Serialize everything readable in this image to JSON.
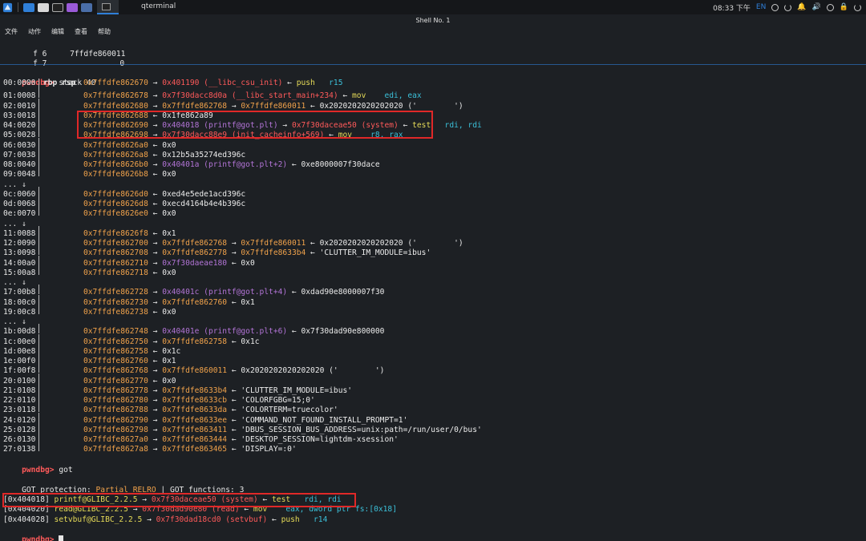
{
  "panel": {
    "task_title": "qterminal",
    "clock": "08:33 下午",
    "lang": "EN"
  },
  "window": {
    "title": "Shell No. 1"
  },
  "menu": {
    "items": [
      "文件",
      "动作",
      "编辑",
      "查看",
      "帮助"
    ]
  },
  "regs": [
    {
      "name": "f 6",
      "value": "7ffdfe860011"
    },
    {
      "name": "f 7",
      "value": "0"
    }
  ],
  "prompt": "pwndbg>",
  "cmd_stack": "stack 40",
  "stack": [
    {
      "idx": "00:0000",
      "tag": "rbp rsp",
      "addr": "0x7ffdfe862670",
      "segs": [
        {
          "t": " → ",
          "c": "white"
        },
        {
          "t": "0x401190 (__libc_csu_init)",
          "c": "red"
        },
        {
          "t": " ← ",
          "c": "white"
        },
        {
          "t": "push",
          "c": "yellow"
        },
        {
          "t": "   r15",
          "c": "cyan"
        }
      ]
    },
    {
      "idx": "01:0008",
      "tag": "",
      "addr": "0x7ffdfe862678",
      "segs": [
        {
          "t": " → ",
          "c": "white"
        },
        {
          "t": "0x7f30dacc8d0a (__libc_start_main+234)",
          "c": "red"
        },
        {
          "t": " ← ",
          "c": "white"
        },
        {
          "t": "mov",
          "c": "yellow"
        },
        {
          "t": "    edi, eax",
          "c": "cyan"
        }
      ]
    },
    {
      "idx": "02:0010",
      "tag": "",
      "addr": "0x7ffdfe862680",
      "segs": [
        {
          "t": " → ",
          "c": "white"
        },
        {
          "t": "0x7ffdfe862768",
          "c": "orange"
        },
        {
          "t": " → ",
          "c": "white"
        },
        {
          "t": "0x7ffdfe860011",
          "c": "orange"
        },
        {
          "t": " ← 0x2020202020202020 ('        ')",
          "c": "white"
        }
      ]
    },
    {
      "idx": "03:0018",
      "tag": "",
      "addr": "0x7ffdfe862688",
      "segs": [
        {
          "t": " ← 0x1fe862a89",
          "c": "white"
        }
      ]
    },
    {
      "idx": "04:0020",
      "tag": "",
      "addr": "0x7ffdfe862690",
      "segs": [
        {
          "t": " → ",
          "c": "white"
        },
        {
          "t": "0x404018 (printf@got.plt)",
          "c": "purple"
        },
        {
          "t": " → ",
          "c": "white"
        },
        {
          "t": "0x7f30daceae50 (system)",
          "c": "red"
        },
        {
          "t": " ← ",
          "c": "white"
        },
        {
          "t": "test",
          "c": "yellow"
        },
        {
          "t": "   rdi, rdi",
          "c": "cyan"
        }
      ]
    },
    {
      "idx": "05:0028",
      "tag": "",
      "addr": "0x7ffdfe862698",
      "segs": [
        {
          "t": " → ",
          "c": "white"
        },
        {
          "t": "0x7f30dacc88e9 (init_cacheinfo+569)",
          "c": "red"
        },
        {
          "t": " ← ",
          "c": "white"
        },
        {
          "t": "mov",
          "c": "yellow"
        },
        {
          "t": "    r8, rax",
          "c": "cyan"
        }
      ]
    },
    {
      "idx": "06:0030",
      "tag": "",
      "addr": "0x7ffdfe8626a0",
      "segs": [
        {
          "t": " ← 0x0",
          "c": "white"
        }
      ]
    },
    {
      "idx": "07:0038",
      "tag": "",
      "addr": "0x7ffdfe8626a8",
      "segs": [
        {
          "t": " ← 0x12b5a35274ed396c",
          "c": "white"
        }
      ]
    },
    {
      "idx": "08:0040",
      "tag": "",
      "addr": "0x7ffdfe8626b0",
      "segs": [
        {
          "t": " → ",
          "c": "white"
        },
        {
          "t": "0x40401a (printf@got.plt+2)",
          "c": "purple"
        },
        {
          "t": " ← 0xe8000007f30dace",
          "c": "white"
        }
      ]
    },
    {
      "idx": "09:0048",
      "tag": "",
      "addr": "0x7ffdfe8626b8",
      "segs": [
        {
          "t": " ← 0x0",
          "c": "white"
        }
      ]
    },
    {
      "idx": "... ↓",
      "tag": "",
      "addr": "",
      "segs": []
    },
    {
      "idx": "0c:0060",
      "tag": "",
      "addr": "0x7ffdfe8626d0",
      "segs": [
        {
          "t": " ← 0xed4e5ede1acd396c",
          "c": "white"
        }
      ]
    },
    {
      "idx": "0d:0068",
      "tag": "",
      "addr": "0x7ffdfe8626d8",
      "segs": [
        {
          "t": " ← 0xecd4164b4e4b396c",
          "c": "white"
        }
      ]
    },
    {
      "idx": "0e:0070",
      "tag": "",
      "addr": "0x7ffdfe8626e0",
      "segs": [
        {
          "t": " ← 0x0",
          "c": "white"
        }
      ]
    },
    {
      "idx": "... ↓",
      "tag": "",
      "addr": "",
      "segs": []
    },
    {
      "idx": "11:0088",
      "tag": "",
      "addr": "0x7ffdfe8626f8",
      "segs": [
        {
          "t": " ← 0x1",
          "c": "white"
        }
      ]
    },
    {
      "idx": "12:0090",
      "tag": "",
      "addr": "0x7ffdfe862700",
      "segs": [
        {
          "t": " → ",
          "c": "white"
        },
        {
          "t": "0x7ffdfe862768",
          "c": "orange"
        },
        {
          "t": " → ",
          "c": "white"
        },
        {
          "t": "0x7ffdfe860011",
          "c": "orange"
        },
        {
          "t": " ← 0x2020202020202020 ('        ')",
          "c": "white"
        }
      ]
    },
    {
      "idx": "13:0098",
      "tag": "",
      "addr": "0x7ffdfe862708",
      "segs": [
        {
          "t": " → ",
          "c": "white"
        },
        {
          "t": "0x7ffdfe862778",
          "c": "orange"
        },
        {
          "t": " → ",
          "c": "white"
        },
        {
          "t": "0x7ffdfe8633b4",
          "c": "orange"
        },
        {
          "t": " ← 'CLUTTER_IM_MODULE=ibus'",
          "c": "white"
        }
      ]
    },
    {
      "idx": "14:00a0",
      "tag": "",
      "addr": "0x7ffdfe862710",
      "segs": [
        {
          "t": " → ",
          "c": "white"
        },
        {
          "t": "0x7f30daeae180",
          "c": "purple"
        },
        {
          "t": " ← 0x0",
          "c": "white"
        }
      ]
    },
    {
      "idx": "15:00a8",
      "tag": "",
      "addr": "0x7ffdfe862718",
      "segs": [
        {
          "t": " ← 0x0",
          "c": "white"
        }
      ]
    },
    {
      "idx": "... ↓",
      "tag": "",
      "addr": "",
      "segs": []
    },
    {
      "idx": "17:00b8",
      "tag": "",
      "addr": "0x7ffdfe862728",
      "segs": [
        {
          "t": " → ",
          "c": "white"
        },
        {
          "t": "0x40401c (printf@got.plt+4)",
          "c": "purple"
        },
        {
          "t": " ← 0xdad90e8000007f30",
          "c": "white"
        }
      ]
    },
    {
      "idx": "18:00c0",
      "tag": "",
      "addr": "0x7ffdfe862730",
      "segs": [
        {
          "t": " → ",
          "c": "white"
        },
        {
          "t": "0x7ffdfe862760",
          "c": "orange"
        },
        {
          "t": " ← 0x1",
          "c": "white"
        }
      ]
    },
    {
      "idx": "19:00c8",
      "tag": "",
      "addr": "0x7ffdfe862738",
      "segs": [
        {
          "t": " ← 0x0",
          "c": "white"
        }
      ]
    },
    {
      "idx": "... ↓",
      "tag": "",
      "addr": "",
      "segs": []
    },
    {
      "idx": "1b:00d8",
      "tag": "",
      "addr": "0x7ffdfe862748",
      "segs": [
        {
          "t": " → ",
          "c": "white"
        },
        {
          "t": "0x40401e (printf@got.plt+6)",
          "c": "purple"
        },
        {
          "t": " ← 0x7f30dad90e800000",
          "c": "white"
        }
      ]
    },
    {
      "idx": "1c:00e0",
      "tag": "",
      "addr": "0x7ffdfe862750",
      "segs": [
        {
          "t": " → ",
          "c": "white"
        },
        {
          "t": "0x7ffdfe862758",
          "c": "orange"
        },
        {
          "t": " ← 0x1c",
          "c": "white"
        }
      ]
    },
    {
      "idx": "1d:00e8",
      "tag": "",
      "addr": "0x7ffdfe862758",
      "segs": [
        {
          "t": " ← 0x1c",
          "c": "white"
        }
      ]
    },
    {
      "idx": "1e:00f0",
      "tag": "",
      "addr": "0x7ffdfe862760",
      "segs": [
        {
          "t": " ← 0x1",
          "c": "white"
        }
      ]
    },
    {
      "idx": "1f:00f8",
      "tag": "",
      "addr": "0x7ffdfe862768",
      "segs": [
        {
          "t": " → ",
          "c": "white"
        },
        {
          "t": "0x7ffdfe860011",
          "c": "orange"
        },
        {
          "t": " ← 0x2020202020202020 ('        ')",
          "c": "white"
        }
      ]
    },
    {
      "idx": "20:0100",
      "tag": "",
      "addr": "0x7ffdfe862770",
      "segs": [
        {
          "t": " ← 0x0",
          "c": "white"
        }
      ]
    },
    {
      "idx": "21:0108",
      "tag": "",
      "addr": "0x7ffdfe862778",
      "segs": [
        {
          "t": " → ",
          "c": "white"
        },
        {
          "t": "0x7ffdfe8633b4",
          "c": "orange"
        },
        {
          "t": " ← 'CLUTTER_IM_MODULE=ibus'",
          "c": "white"
        }
      ]
    },
    {
      "idx": "22:0110",
      "tag": "",
      "addr": "0x7ffdfe862780",
      "segs": [
        {
          "t": " → ",
          "c": "white"
        },
        {
          "t": "0x7ffdfe8633cb",
          "c": "orange"
        },
        {
          "t": " ← 'COLORFGBG=15;0'",
          "c": "white"
        }
      ]
    },
    {
      "idx": "23:0118",
      "tag": "",
      "addr": "0x7ffdfe862788",
      "segs": [
        {
          "t": " → ",
          "c": "white"
        },
        {
          "t": "0x7ffdfe8633da",
          "c": "orange"
        },
        {
          "t": " ← 'COLORTERM=truecolor'",
          "c": "white"
        }
      ]
    },
    {
      "idx": "24:0120",
      "tag": "",
      "addr": "0x7ffdfe862790",
      "segs": [
        {
          "t": " → ",
          "c": "white"
        },
        {
          "t": "0x7ffdfe8633ee",
          "c": "orange"
        },
        {
          "t": " ← 'COMMAND_NOT_FOUND_INSTALL_PROMPT=1'",
          "c": "white"
        }
      ]
    },
    {
      "idx": "25:0128",
      "tag": "",
      "addr": "0x7ffdfe862798",
      "segs": [
        {
          "t": " → ",
          "c": "white"
        },
        {
          "t": "0x7ffdfe863411",
          "c": "orange"
        },
        {
          "t": " ← 'DBUS_SESSION_BUS_ADDRESS=unix:path=/run/user/0/bus'",
          "c": "white"
        }
      ]
    },
    {
      "idx": "26:0130",
      "tag": "",
      "addr": "0x7ffdfe8627a0",
      "segs": [
        {
          "t": " → ",
          "c": "white"
        },
        {
          "t": "0x7ffdfe863444",
          "c": "orange"
        },
        {
          "t": " ← 'DESKTOP_SESSION=lightdm-xsession'",
          "c": "white"
        }
      ]
    },
    {
      "idx": "27:0138",
      "tag": "",
      "addr": "0x7ffdfe8627a8",
      "segs": [
        {
          "t": " → ",
          "c": "white"
        },
        {
          "t": "0x7ffdfe863465",
          "c": "orange"
        },
        {
          "t": " ← 'DISPLAY=:0'",
          "c": "white"
        }
      ]
    }
  ],
  "cmd_got": "got",
  "got_header": {
    "prefix": "GOT protection: ",
    "relro": "Partial RELRO",
    "suffix": " | GOT functions: 3"
  },
  "got": [
    {
      "slot": "[0x404018]",
      "sym": "printf@GLIBC_2.2.5",
      "segs": [
        {
          "t": " → ",
          "c": "white"
        },
        {
          "t": "0x7f30daceae50 (system)",
          "c": "red"
        },
        {
          "t": " ← ",
          "c": "white"
        },
        {
          "t": "test",
          "c": "yellow"
        },
        {
          "t": "   rdi, rdi",
          "c": "cyan"
        }
      ]
    },
    {
      "slot": "[0x404020]",
      "sym": "read@GLIBC_2.2.5",
      "segs": [
        {
          "t": " → ",
          "c": "white"
        },
        {
          "t": "0x7f30dad90e80 (read)",
          "c": "red"
        },
        {
          "t": " ← ",
          "c": "white"
        },
        {
          "t": "mov",
          "c": "yellow"
        },
        {
          "t": "    eax, dword ptr fs:[0x18]",
          "c": "cyan"
        }
      ]
    },
    {
      "slot": "[0x404028]",
      "sym": "setvbuf@GLIBC_2.2.5",
      "segs": [
        {
          "t": " → ",
          "c": "white"
        },
        {
          "t": "0x7f30dad18cd0 (setvbuf)",
          "c": "red"
        },
        {
          "t": " ← ",
          "c": "white"
        },
        {
          "t": "push",
          "c": "yellow"
        },
        {
          "t": "   r14",
          "c": "cyan"
        }
      ]
    }
  ]
}
